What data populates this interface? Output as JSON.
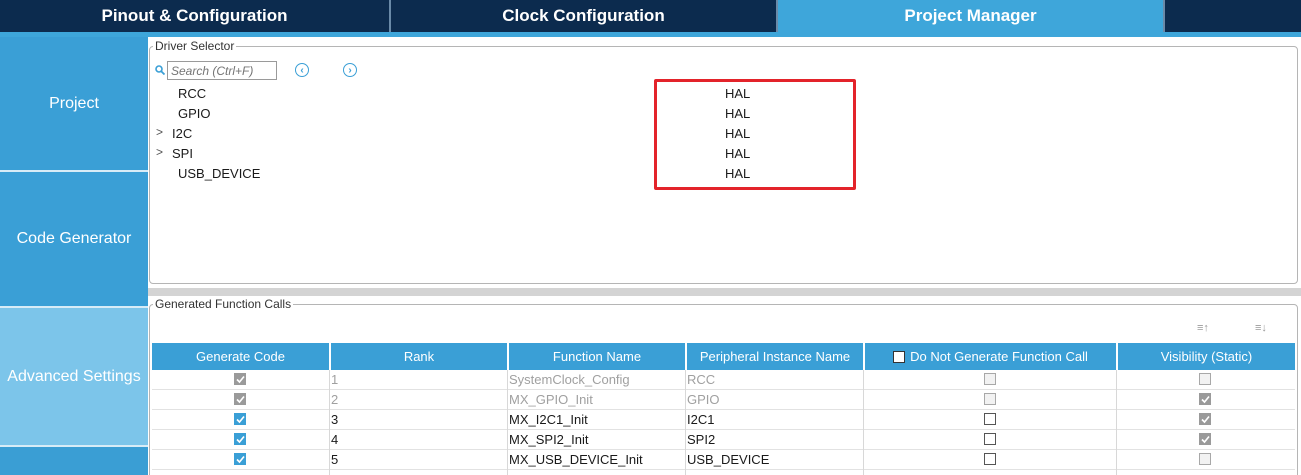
{
  "tabs": [
    {
      "label": "Pinout & Configuration"
    },
    {
      "label": "Clock Configuration"
    },
    {
      "label": "Project Manager"
    }
  ],
  "leftnav": {
    "items": [
      {
        "label": "Project"
      },
      {
        "label": "Code Generator"
      },
      {
        "label": "Advanced Settings"
      }
    ]
  },
  "driver_selector": {
    "legend": "Driver Selector",
    "search_placeholder": "Search (Ctrl+F)",
    "rows": [
      {
        "name": "RCC",
        "value": "HAL",
        "expandable": false
      },
      {
        "name": "GPIO",
        "value": "HAL",
        "expandable": false
      },
      {
        "name": "I2C",
        "value": "HAL",
        "expandable": true
      },
      {
        "name": "SPI",
        "value": "HAL",
        "expandable": true
      },
      {
        "name": "USB_DEVICE",
        "value": "HAL",
        "expandable": false
      }
    ]
  },
  "generated_calls": {
    "legend": "Generated Function Calls",
    "columns": [
      "Generate Code",
      "Rank",
      "Function Name",
      "Peripheral Instance Name",
      "Do Not Generate Function Call",
      "Visibility (Static)"
    ],
    "rows": [
      {
        "generate": true,
        "generate_disabled": true,
        "rank": "1",
        "function": "SystemClock_Config",
        "instance": "RCC",
        "do_not_generate": false,
        "dng_disabled": true,
        "visibility": false,
        "vis_disabled": true,
        "dim": true
      },
      {
        "generate": true,
        "generate_disabled": true,
        "rank": "2",
        "function": "MX_GPIO_Init",
        "instance": "GPIO",
        "do_not_generate": false,
        "dng_disabled": true,
        "visibility": true,
        "vis_disabled": true,
        "dim": true
      },
      {
        "generate": true,
        "generate_disabled": false,
        "rank": "3",
        "function": "MX_I2C1_Init",
        "instance": "I2C1",
        "do_not_generate": false,
        "dng_disabled": false,
        "visibility": true,
        "vis_disabled": true,
        "dim": false
      },
      {
        "generate": true,
        "generate_disabled": false,
        "rank": "4",
        "function": "MX_SPI2_Init",
        "instance": "SPI2",
        "do_not_generate": false,
        "dng_disabled": false,
        "visibility": true,
        "vis_disabled": true,
        "dim": false
      },
      {
        "generate": true,
        "generate_disabled": false,
        "rank": "5",
        "function": "MX_USB_DEVICE_Init",
        "instance": "USB_DEVICE",
        "do_not_generate": false,
        "dng_disabled": false,
        "visibility": false,
        "vis_disabled": true,
        "dim": false
      }
    ]
  },
  "colors": {
    "accent": "#3a9fd6",
    "dark_tab": "#0c2b4e",
    "highlight": "#e3232a"
  },
  "icons": [
    "search-icon",
    "previous-icon",
    "next-icon",
    "sort-ascending-icon",
    "sort-descending-icon",
    "chevron-right-icon"
  ]
}
